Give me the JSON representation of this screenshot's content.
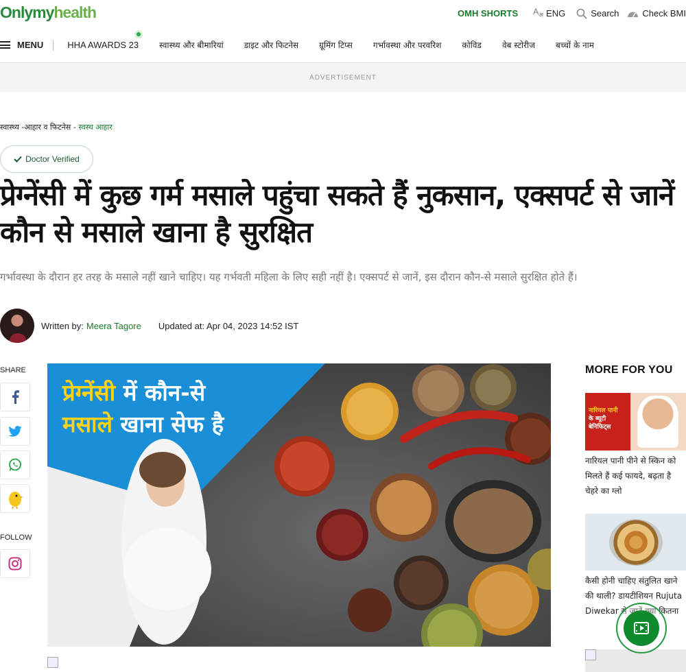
{
  "brand": {
    "logo_dark": "Onlymy",
    "logo_light": "health"
  },
  "topbar": {
    "shorts": "OMH SHORTS",
    "lang_glyph": "A",
    "lang_sub": "अ",
    "lang": "ENG",
    "search": "Search",
    "bmi": "Check BMI"
  },
  "nav": {
    "menu": "MENU",
    "items": [
      "HHA AWARDS 23",
      "स्वास्थ्य और बीमारियां",
      "डाइट और फिटनेस",
      "ग्रूमिंग टिप्स",
      "गर्भावस्था और परवरिश",
      "कोविड",
      "वेब स्टोरीज",
      "बच्चों के नाम"
    ]
  },
  "ad_label": "ADVERTISEMENT",
  "breadcrumb": {
    "parent": "स्वास्थ्य -आहार व फिटनेस",
    "sep": " - ",
    "current": "स्वस्थ आहार"
  },
  "verified": "Doctor Verified",
  "article": {
    "headline": "प्रेग्नेंसी में कुछ गर्म मसाले पहुंचा सकते हैं नुकसान, एक्सपर्ट से जानें कौन से मसाले खाना है सुरक्षित",
    "summary": "गर्भावस्था के दौरान हर तरह के मसाले नहीं खाने चाहिए। यह गर्भवती महिला के लिए सही नहीं है। एक्सपर्ट से जानें, इस दौरान कौन-से मसाले सुरक्षित होते हैं।",
    "written_by": "Written by:",
    "author": "Meera Tagore",
    "updated": "Updated at: Apr 04, 2023 14:52 IST",
    "hero_line1_hl": "प्रेग्नेंसी",
    "hero_line1": " में कौन-से",
    "hero_line2_hl": "मसाले",
    "hero_line2": " खाना सेफ है"
  },
  "share": {
    "label": "SHARE",
    "follow": "FOLLOW"
  },
  "sidebar": {
    "title": "MORE FOR YOU",
    "thumb1_line1": "नारियल पानी",
    "thumb1_line2": "के ब्यूटी",
    "thumb1_line3": "बेनिफिट्स",
    "story1": "नारियल पानी पीने से स्किन को मिलते हैं कई फायदे, बढ़ता है चेहरे का ग्लो",
    "story2": "कैसी होनी चाहिए संतुलित खाने की थाली? डायटीशियन Rujuta Diwekar से जानें क्या कितना"
  },
  "colors": {
    "brand_green": "#1a7a2c",
    "headline": "#111111",
    "summary": "#777777"
  }
}
